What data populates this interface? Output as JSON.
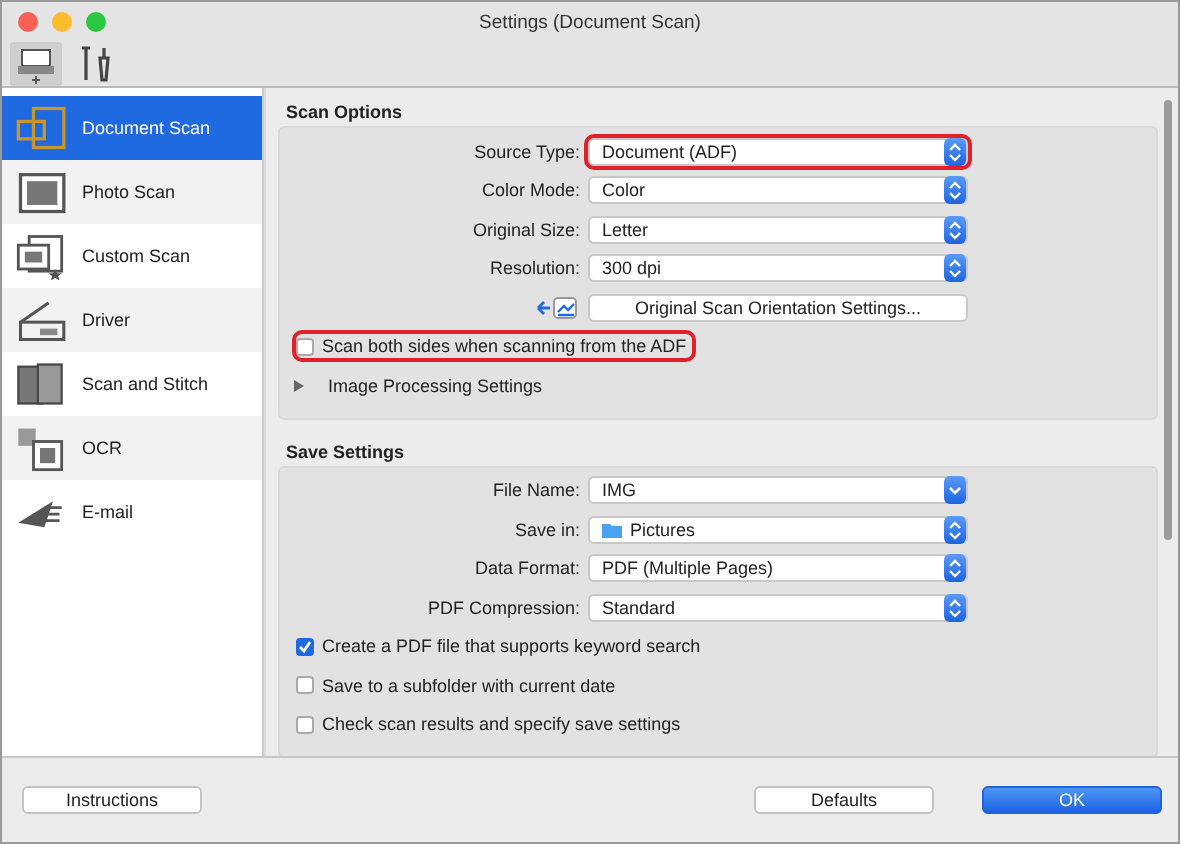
{
  "window": {
    "title": "Settings (Document Scan)"
  },
  "toolbar": [
    {
      "kind": "scan",
      "selected": true
    },
    {
      "kind": "tools",
      "selected": false
    }
  ],
  "sidebar": {
    "items": [
      {
        "label": "Document Scan",
        "selected": true
      },
      {
        "label": "Photo Scan",
        "selected": false
      },
      {
        "label": "Custom Scan",
        "selected": false
      },
      {
        "label": "Driver",
        "selected": false
      },
      {
        "label": "Scan and Stitch",
        "selected": false
      },
      {
        "label": "OCR",
        "selected": false
      },
      {
        "label": "E-mail",
        "selected": false
      }
    ]
  },
  "sections": [
    {
      "title": "Scan Options",
      "rows": [
        {
          "kind": "popup",
          "label": "Source Type:",
          "value": "Document (ADF)",
          "highlighted": true
        },
        {
          "kind": "popup",
          "label": "Color Mode:",
          "value": "Color",
          "highlighted": false
        },
        {
          "kind": "popup",
          "label": "Original Size:",
          "value": "Letter",
          "highlighted": false
        },
        {
          "kind": "popup",
          "label": "Resolution:",
          "value": "300 dpi",
          "highlighted": false
        },
        {
          "kind": "button",
          "value": "Original Scan Orientation Settings..."
        },
        {
          "kind": "checkbox",
          "label": "Scan both sides when scanning from the ADF",
          "checked": false,
          "highlighted": true
        },
        {
          "kind": "disclosure",
          "label": "Image Processing Settings",
          "expanded": false
        }
      ]
    },
    {
      "title": "Save Settings",
      "rows": [
        {
          "kind": "combo",
          "label": "File Name:",
          "value": "IMG",
          "highlighted": false
        },
        {
          "kind": "folder",
          "label": "Save in:",
          "value": "Pictures",
          "highlighted": false
        },
        {
          "kind": "popup",
          "label": "Data Format:",
          "value": "PDF (Multiple Pages)",
          "highlighted": false
        },
        {
          "kind": "popup",
          "label": "PDF Compression:",
          "value": "Standard",
          "highlighted": false
        },
        {
          "kind": "checkbox",
          "label": "Create a PDF file that supports keyword search",
          "checked": true,
          "highlighted": false
        },
        {
          "kind": "checkbox",
          "label": "Save to a subfolder with current date",
          "checked": false,
          "highlighted": false
        },
        {
          "kind": "checkbox",
          "label": "Check scan results and specify save settings",
          "checked": false,
          "highlighted": false
        }
      ]
    }
  ],
  "buttons": [
    {
      "kind": "plain",
      "label": "Instructions"
    },
    {
      "kind": "plain",
      "label": "Defaults"
    },
    {
      "kind": "default",
      "label": "OK"
    }
  ]
}
